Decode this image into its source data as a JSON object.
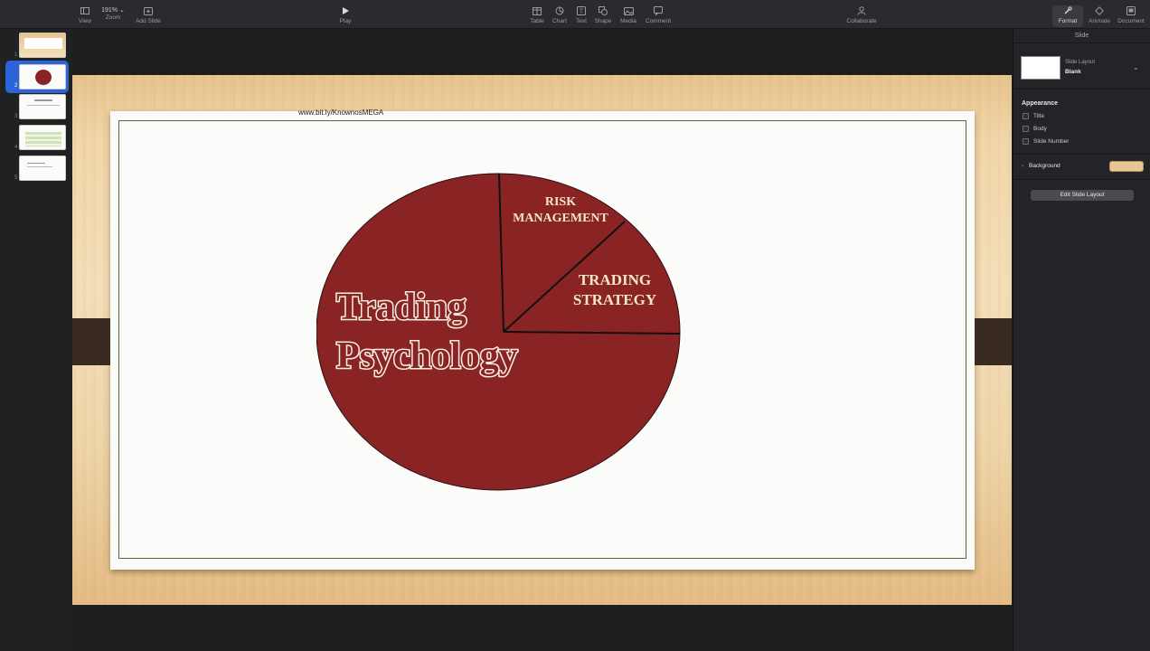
{
  "toolbar": {
    "view_label": "View",
    "zoom_value": "191%",
    "zoom_label": "Zoom",
    "add_slide_label": "Add Slide",
    "play_label": "Play",
    "table_label": "Table",
    "chart_label": "Chart",
    "text_label": "Text",
    "shape_label": "Shape",
    "media_label": "Media",
    "comment_label": "Comment",
    "collaborate_label": "Collaborate",
    "format_label": "Format",
    "animate_label": "Animate",
    "document_label": "Document"
  },
  "navigator": {
    "slides": [
      {
        "num": "1"
      },
      {
        "num": "2"
      },
      {
        "num": "3"
      },
      {
        "num": "4"
      },
      {
        "num": "5"
      }
    ],
    "selected": 2
  },
  "slide": {
    "link_text": "www.bit.ly/KnownosMEGA",
    "main_label_line1": "Trading",
    "main_label_line2": "Psychology",
    "slice1_line1": "RISK",
    "slice1_line2": "MANAGEMENT",
    "slice2_line1": "TRADING",
    "slice2_line2": "STRATEGY",
    "pie_color": "#8a2424"
  },
  "inspector": {
    "header": "Slide",
    "layout_small_label": "Slide Layout",
    "layout_value": "Blank",
    "appearance_label": "Appearance",
    "checkboxes": [
      {
        "label": "Title"
      },
      {
        "label": "Body"
      },
      {
        "label": "Slide Number"
      }
    ],
    "background_label": "Background",
    "background_color": "#e9c594",
    "edit_button_label": "Edit Slide Layout"
  }
}
